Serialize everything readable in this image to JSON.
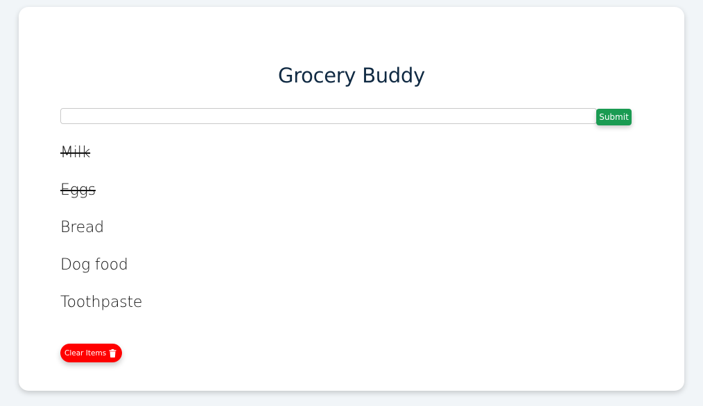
{
  "app": {
    "title": "Grocery Buddy"
  },
  "form": {
    "input_value": "",
    "input_placeholder": "",
    "submit_label": "Submit"
  },
  "items": [
    {
      "label": "Milk",
      "completed": true
    },
    {
      "label": "Eggs",
      "completed": true
    },
    {
      "label": "Bread",
      "completed": false
    },
    {
      "label": "Dog food",
      "completed": false
    },
    {
      "label": "Toothpaste",
      "completed": false
    }
  ],
  "actions": {
    "clear_label": "Clear Items",
    "clear_icon": "trash-icon"
  },
  "colors": {
    "background": "#f1f5f8",
    "title": "#102a43",
    "submit": "#1a9b52",
    "clear": "#ff0000"
  }
}
